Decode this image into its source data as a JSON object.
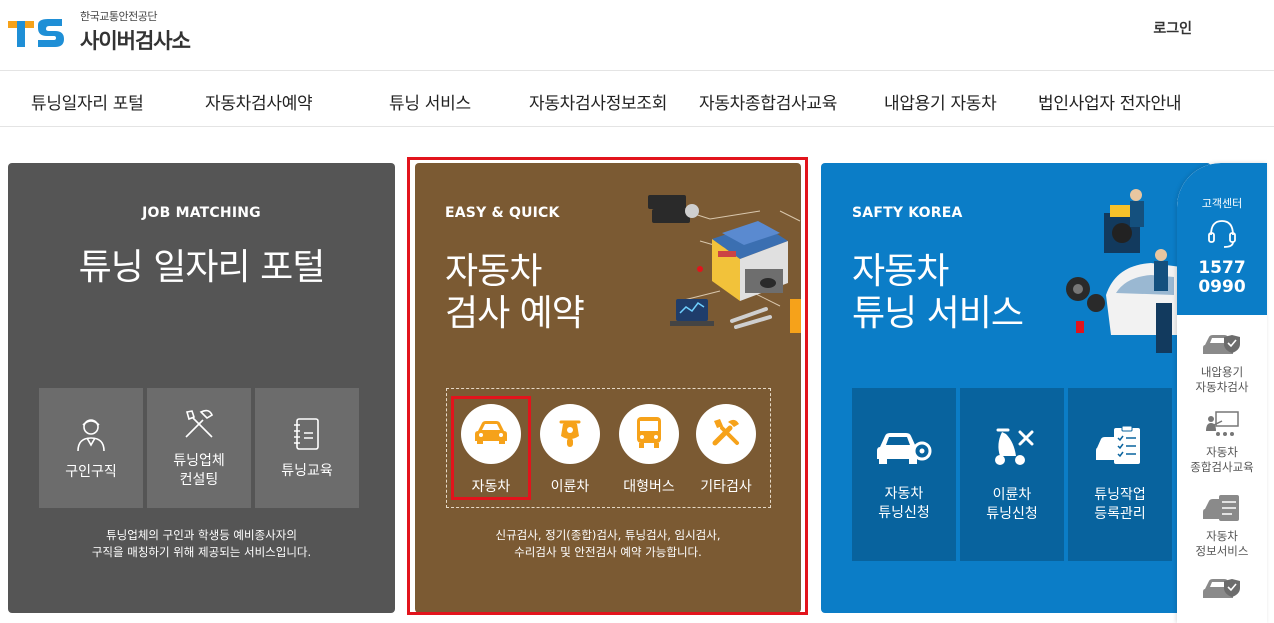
{
  "header": {
    "logo_mark": "TS",
    "org_name": "한국교통안전공단",
    "site_name": "사이버검사소",
    "login_label": "로그인"
  },
  "nav": [
    "튜닝일자리 포털",
    "자동차검사예약",
    "튜닝 서비스",
    "자동차검사정보조회",
    "자동차종합검사교육",
    "내압용기 자동차",
    "법인사업자 전자안내"
  ],
  "job": {
    "eyebrow": "JOB MATCHING",
    "title": "튜닝 일자리 포털",
    "tiles": [
      {
        "label": "구인구직",
        "icon": "worker-icon"
      },
      {
        "label": "튜닝업체\n컨설팅",
        "icon": "tools-icon"
      },
      {
        "label": "튜닝교육",
        "icon": "notebook-icon"
      }
    ],
    "desc_line1": "튜닝업체의 구인과 학생등 예비종사자의",
    "desc_line2": "구직을 매칭하기 위해 제공되는 서비스입니다."
  },
  "exam": {
    "eyebrow": "EASY & QUICK",
    "title_line1": "자동차",
    "title_line2": "검사 예약",
    "vehicles": [
      {
        "label": "자동차",
        "icon": "car-icon",
        "selected": true
      },
      {
        "label": "이륜차",
        "icon": "motorcycle-icon",
        "selected": false
      },
      {
        "label": "대형버스",
        "icon": "bus-icon",
        "selected": false
      },
      {
        "label": "기타검사",
        "icon": "wrench-icon",
        "selected": false
      }
    ],
    "desc_line1": "신규검사, 정기(종합)검사, 튜닝검사, 임시검사,",
    "desc_line2": "수리검사 및 안전검사 예약 가능합니다."
  },
  "safety": {
    "eyebrow": "SAFTY KOREA",
    "title_line1": "자동차",
    "title_line2": "튜닝 서비스",
    "tiles": [
      {
        "label": "자동차\n튜닝신청",
        "icon": "car-gear-icon"
      },
      {
        "label": "이륜차\n튜닝신청",
        "icon": "scooter-icon"
      },
      {
        "label": "튜닝작업\n등록관리",
        "icon": "checklist-icon"
      }
    ]
  },
  "quickbar": {
    "title": "고객센터",
    "phone_line1": "1577",
    "phone_line2": "0990",
    "items": [
      {
        "label": "내압용기\n자동차검사",
        "icon": "car-shield-icon"
      },
      {
        "label": "자동차\n종합검사교육",
        "icon": "lecture-icon"
      },
      {
        "label": "자동차\n정보서비스",
        "icon": "car-doc-icon"
      },
      {
        "label": "",
        "icon": "car-shield-icon"
      }
    ]
  },
  "colors": {
    "job_bg": "#555555",
    "exam_bg": "#7b5a33",
    "safety_bg": "#0b7dc7",
    "accent_orange": "#f6a21a",
    "highlight_red": "#e2141c"
  }
}
